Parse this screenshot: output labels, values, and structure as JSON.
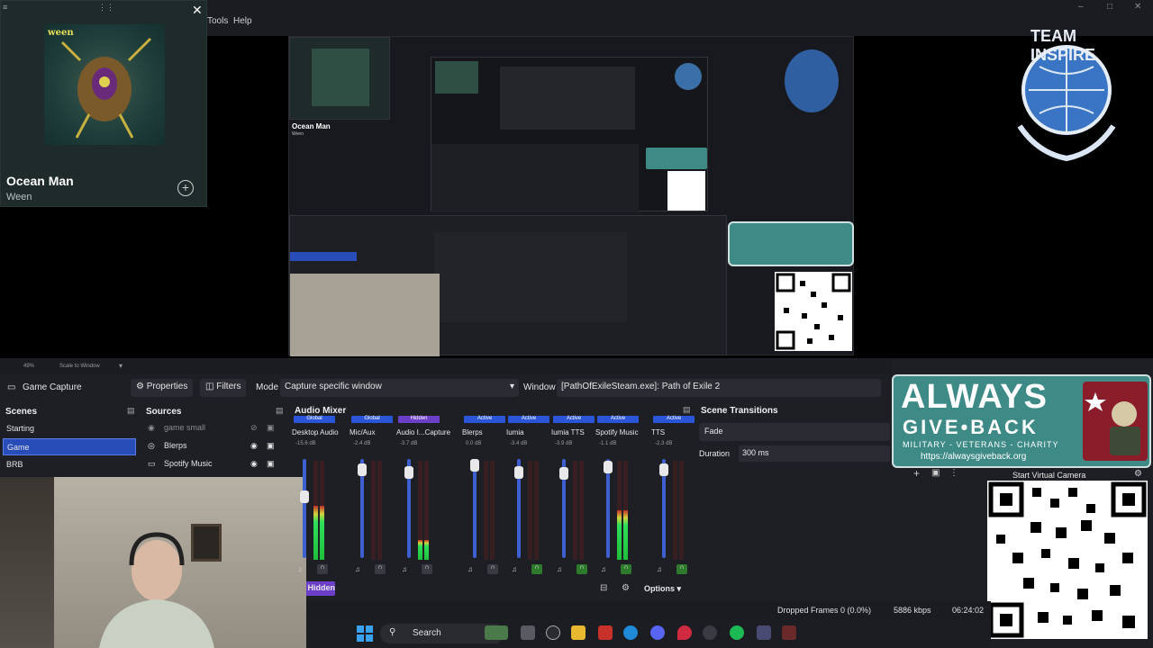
{
  "menu": {
    "tools": "Tools",
    "help": "Help"
  },
  "spotify": {
    "title": "Ocean Man",
    "artist": "Ween",
    "album_text": "ween",
    "nested_title": "Ocean Man",
    "nested_artist": "Ween"
  },
  "logos": {
    "team_text": "TEAM INSPIRE",
    "agb_line1": "ALWAYS",
    "agb_line2": "GIVE•BACK",
    "agb_line3": "MILITARY - VETERANS - CHARITY",
    "agb_url": "https://alwaysgiveback.org"
  },
  "toolbar": {
    "zoom": "49%",
    "scale": "Scale to Window"
  },
  "properties_bar": {
    "source": "Game Capture",
    "properties": "Properties",
    "filters": "Filters",
    "mode_label": "Mode",
    "mode_value": "Capture specific window",
    "window_label": "Window",
    "window_value": "[PathOfExileSteam.exe]: Path of Exile 2"
  },
  "scenes": {
    "title": "Scenes",
    "items": [
      "Starting",
      "Game",
      "BRB"
    ],
    "active_index": 1
  },
  "sources": {
    "title": "Sources",
    "items": [
      "game small",
      "Blerps",
      "Spotify Music"
    ]
  },
  "mixer": {
    "title": "Audio Mixer",
    "channels": [
      {
        "tag": "Global",
        "tag_color": "#2a55d8",
        "name": "Desktop Audio",
        "db": "-15.6 dB",
        "fader": 0.35,
        "level": 0.55
      },
      {
        "tag": "Global",
        "tag_color": "#2a55d8",
        "name": "Mic/Aux",
        "db": "-2.4 dB",
        "fader": 0.05,
        "level": 0.0
      },
      {
        "tag": "Hidden",
        "tag_color": "#6c3fc8",
        "name": "Audio I...Capture",
        "db": "-3.7 dB",
        "fader": 0.08,
        "level": 0.2
      },
      {
        "tag": "Active",
        "tag_color": "#2a55d8",
        "name": "Blerps",
        "db": "0.0 dB",
        "fader": 0.0,
        "level": 0.0
      },
      {
        "tag": "Active",
        "tag_color": "#2a55d8",
        "name": "Iumia",
        "db": "-3.4 dB",
        "fader": 0.08,
        "level": 0.0
      },
      {
        "tag": "Active",
        "tag_color": "#2a55d8",
        "name": "Iumia TTS",
        "db": "-3.9 dB",
        "fader": 0.09,
        "level": 0.0
      },
      {
        "tag": "Active",
        "tag_color": "#2a55d8",
        "name": "Spotify Music",
        "db": "-1.1 dB",
        "fader": 0.02,
        "level": 0.5
      },
      {
        "tag": "Active",
        "tag_color": "#2a55d8",
        "name": "TTS",
        "db": "-2.3 dB",
        "fader": 0.05,
        "level": 0.0
      }
    ],
    "hidden_label": "Hidden",
    "options": "Options"
  },
  "transitions": {
    "title": "Scene Transitions",
    "type": "Fade",
    "duration_label": "Duration",
    "duration_value": "300 ms"
  },
  "virtual_camera": "Start Virtual Camera",
  "status": {
    "dropped": "Dropped Frames 0 (0.0%)",
    "kbps": "5886 kbps",
    "time": "06:24:02"
  },
  "taskbar": {
    "search": "Search"
  },
  "colors": {
    "accent": "#284cb8",
    "agb_teal": "#3e8a86",
    "agb_red": "#8b1c2a"
  }
}
